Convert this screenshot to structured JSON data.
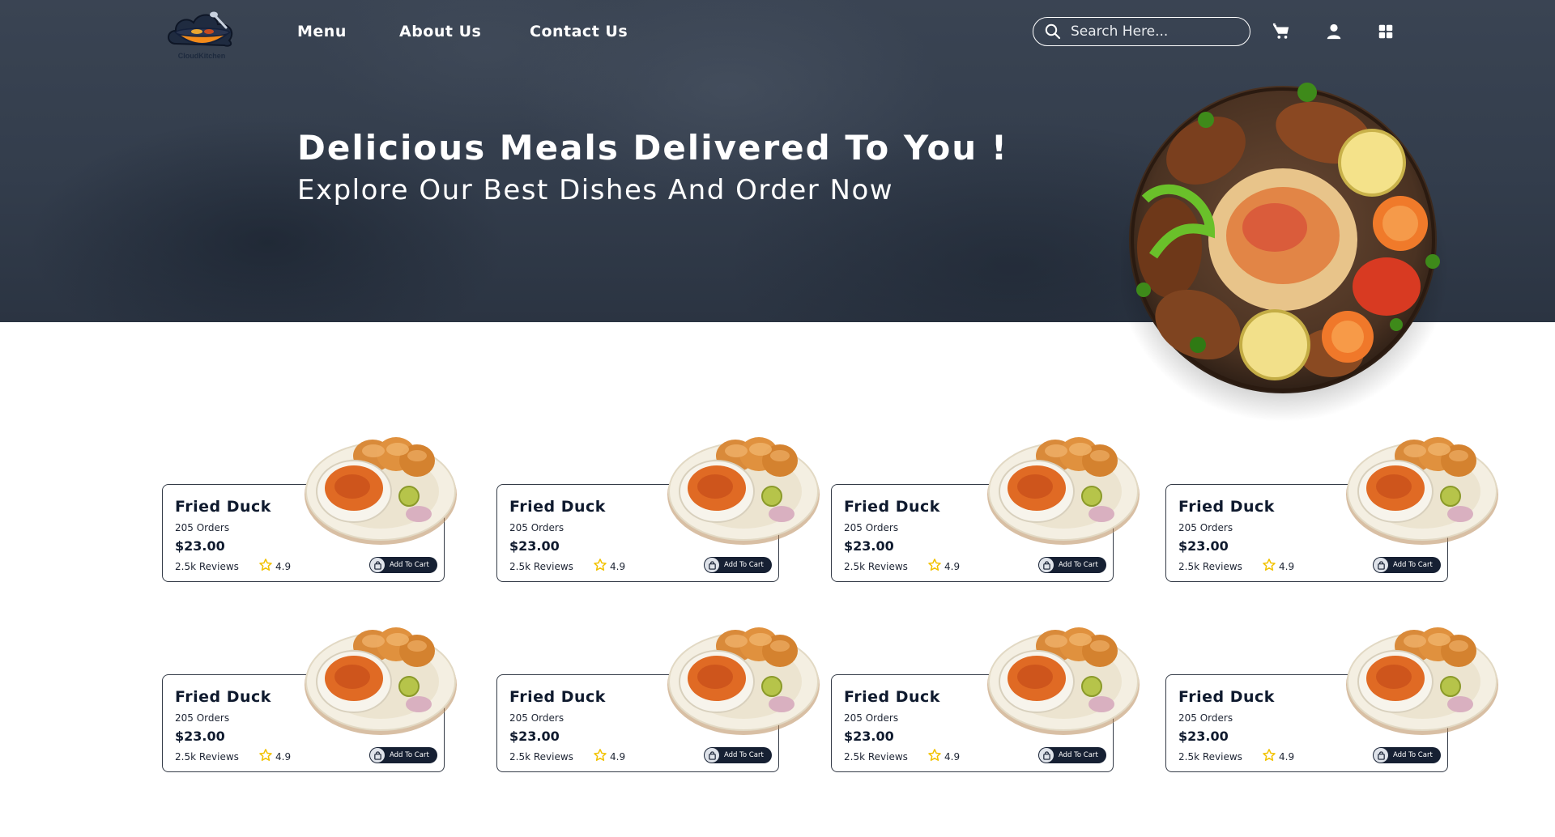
{
  "header": {
    "logo_text": "CloudKitchen",
    "nav": [
      {
        "label": "Menu"
      },
      {
        "label": "About Us"
      },
      {
        "label": "Contact Us"
      }
    ],
    "search": {
      "placeholder": "Search Here..."
    },
    "icons": [
      "cart-icon",
      "user-icon",
      "grid-menu-icon"
    ]
  },
  "hero": {
    "title": "Delicious Meals Delivered To You !",
    "subtitle": "Explore Our Best Dishes And Order Now"
  },
  "colors": {
    "hero_bg": "#343e4d",
    "accent_dark": "#162033",
    "star": "#f2c200",
    "card_border": "#343b47"
  },
  "dishes": [
    {
      "name": "Fried Duck",
      "orders": "205 Orders",
      "price": "$23.00",
      "reviews": "2.5k Reviews",
      "rating": "4.9",
      "button": "Add To Cart"
    },
    {
      "name": "Fried Duck",
      "orders": "205 Orders",
      "price": "$23.00",
      "reviews": "2.5k Reviews",
      "rating": "4.9",
      "button": "Add To Cart"
    },
    {
      "name": "Fried Duck",
      "orders": "205 Orders",
      "price": "$23.00",
      "reviews": "2.5k Reviews",
      "rating": "4.9",
      "button": "Add To Cart"
    },
    {
      "name": "Fried Duck",
      "orders": "205 Orders",
      "price": "$23.00",
      "reviews": "2.5k Reviews",
      "rating": "4.9",
      "button": "Add To Cart"
    },
    {
      "name": "Fried Duck",
      "orders": "205 Orders",
      "price": "$23.00",
      "reviews": "2.5k Reviews",
      "rating": "4.9",
      "button": "Add To Cart"
    },
    {
      "name": "Fried Duck",
      "orders": "205 Orders",
      "price": "$23.00",
      "reviews": "2.5k Reviews",
      "rating": "4.9",
      "button": "Add To Cart"
    },
    {
      "name": "Fried Duck",
      "orders": "205 Orders",
      "price": "$23.00",
      "reviews": "2.5k Reviews",
      "rating": "4.9",
      "button": "Add To Cart"
    },
    {
      "name": "Fried Duck",
      "orders": "205 Orders",
      "price": "$23.00",
      "reviews": "2.5k Reviews",
      "rating": "4.9",
      "button": "Add To Cart"
    }
  ]
}
